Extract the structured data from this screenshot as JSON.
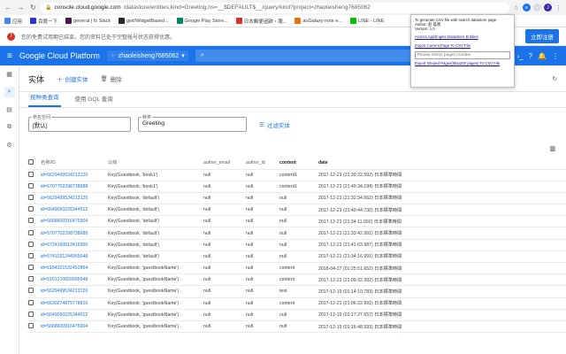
{
  "browser": {
    "url_host": "console.cloud.google.com",
    "url_path": "/datastore/entities;kind=Greeting;ns=__$DEFAULT$__/query/kind?project=zhaoleisheng7685062",
    "bookmarks": [
      {
        "label": "应用",
        "color": "#4285f4"
      },
      {
        "label": "百度一下",
        "color": "#2932e1"
      },
      {
        "label": "general | fs Slack",
        "color": "#4a154b"
      },
      {
        "label": "gwt/WidgetBased...",
        "color": "#24292e"
      },
      {
        "label": "Google Play Store...",
        "color": "#01875f"
      },
      {
        "label": "日本郵便追跡・服...",
        "color": "#d93025"
      },
      {
        "label": "auGalaxy note e...",
        "color": "#e8710a"
      },
      {
        "label": "LINE - LINE",
        "color": "#00c300"
      }
    ]
  },
  "banner": {
    "message": "您的免费试用期已结束。您的资料已处于完整帐号状态获得优惠。",
    "dismiss": "关闭",
    "upgrade": "立即注册"
  },
  "gcp": {
    "title": "Google Cloud Platform",
    "project": "zhaoleisheng7685062"
  },
  "toolbar": {
    "title": "实体",
    "create": "创建实体",
    "delete": "删除"
  },
  "tabs": [
    "按种类查询",
    "使用 GQL 查询"
  ],
  "filters": {
    "namespace_label": "命名空间",
    "namespace_value": "[默认]",
    "kind_label": "种类",
    "kind_value": "Greeting",
    "filter_button": "过滤实体"
  },
  "table": {
    "headers": [
      "名称/ID",
      "父级",
      "author_email",
      "author_id",
      "content",
      "date"
    ],
    "rows": [
      [
        "id=5629499534213120",
        "Key(Guestbook, 'book1')",
        "null",
        "null",
        "content1",
        "2017-12-21 (21:39:22.592) 日本標準時間"
      ],
      [
        "id=5707702298738688",
        "Key(Guestbook, 'book1')",
        "null",
        "null",
        "content1",
        "2017-12-21 (21:40:34.194) 日本標準時間"
      ],
      [
        "id=5629499534213120",
        "Key(Guestbook, 'default')",
        "null",
        "null",
        "null",
        "2017-12-21 (21:32:34.662) 日本標準時間"
      ],
      [
        "id=5649050225344512",
        "Key(Guestbook, 'default')",
        "null",
        "null",
        "null",
        "2017-12-21 (21:40:44.730) 日本標準時間"
      ],
      [
        "id=5668600916475904",
        "Key(Guestbook, 'default')",
        "null",
        "null",
        "null",
        "2017-12-21 (21:34:11.092) 日本標準時間"
      ],
      [
        "id=5707702298738688",
        "Key(Guestbook, 'default')",
        "null",
        "null",
        "null",
        "2017-12-21 (21:33:42.991) 日本標準時間"
      ],
      [
        "id=5724160613416960",
        "Key(Guestbook, 'default')",
        "null",
        "null",
        "null",
        "2017-12-21 (21:41:03.987) 日本標準時間"
      ],
      [
        "id=5741031244955648",
        "Key(Guestbook, 'default')",
        "null",
        "null",
        "null",
        "2017-12-21 (21:34:16.991) 日本標準時間"
      ],
      [
        "id=5154321532452864",
        "Key(Guestbook, 'guestbookName')",
        "null",
        "null",
        "content",
        "2018-04-27 (01:25:51.652) 日本標準時間"
      ],
      [
        "id=5161210659995648",
        "Key(Guestbook, 'guestbookName')",
        "null",
        "null",
        "content",
        "2017-12-21 (21:09:32.392) 日本標準時間"
      ],
      [
        "id=5629499534213120",
        "Key(Guestbook, 'guestbookName')",
        "null",
        "null",
        "test",
        "2017-12-19 (01:14:10.783) 日本標準時間"
      ],
      [
        "id=5630274879778816",
        "Key(Guestbook, 'guestbookName')",
        "null",
        "null",
        "content",
        "2017-12-21 (21:06:22.991) 日本標準時間"
      ],
      [
        "id=5649050225344512",
        "Key(Guestbook, 'guestbookName')",
        "null",
        "null",
        "null",
        "2017-12-19 (01:17:27.657) 日本標準時間"
      ],
      [
        "id=5668600916475904",
        "Key(Guestbook, 'guestbookName')",
        "null",
        "null",
        "null",
        "2017-12-19 (01:16:48.593) 日本標準時間"
      ]
    ]
  },
  "popup": {
    "lines": [
      "To generate CSV file with search datastore page",
      "Author: 赵 晶晓",
      "Version: 1.0"
    ],
    "link_access": "Access AppEngine DataStore Entities",
    "link_export_current": "Export Current Page To CSV File",
    "input_placeholder": "Please select pages number",
    "link_export_selected": "Export Slected Pages(Max200 pages) To CSV File"
  }
}
